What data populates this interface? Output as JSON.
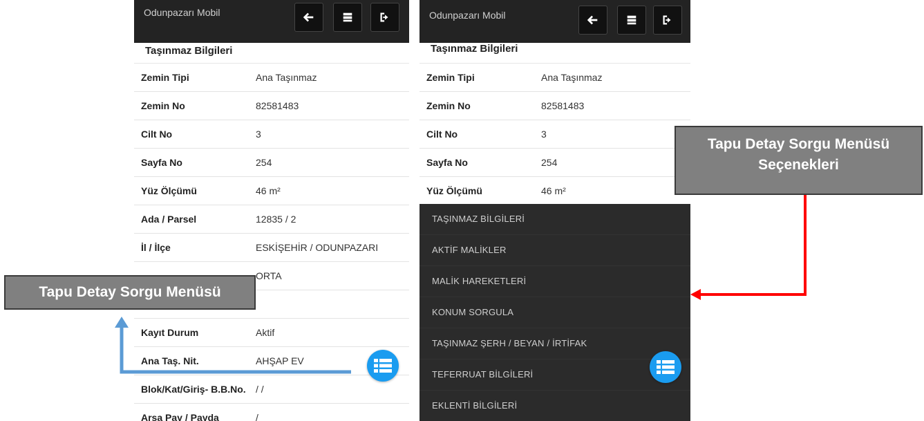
{
  "app": {
    "title": "Odunpazarı Mobil"
  },
  "header_buttons": [
    {
      "icon": "arrow-left-icon"
    },
    {
      "icon": "server-list-icon"
    },
    {
      "icon": "sign-out-icon"
    }
  ],
  "section_title": "Taşınmaz Bilgileri",
  "fields": [
    {
      "label": "Zemin Tipi",
      "value": "Ana Taşınmaz"
    },
    {
      "label": "Zemin No",
      "value": "82581483"
    },
    {
      "label": "Cilt No",
      "value": "3"
    },
    {
      "label": "Sayfa No",
      "value": "254"
    },
    {
      "label": "Yüz Ölçümü",
      "value": "46 m²"
    },
    {
      "label": "Ada / Parsel",
      "value": "12835  / 2"
    },
    {
      "label": "İl / İlçe",
      "value": "ESKİŞEHİR /  ODUNPAZARI"
    },
    {
      "label": "",
      "value": "ORTA"
    },
    {
      "label": "",
      "value": ""
    },
    {
      "label": "Kayıt Durum",
      "value": "Aktif"
    },
    {
      "label": "Ana Taş. Nit.",
      "value": "AHŞAP EV"
    },
    {
      "label": "Blok/Kat/Giriş- B.B.No.",
      "value": "/   /"
    },
    {
      "label": "Arsa Pay / Payda",
      "value": "/"
    }
  ],
  "menu_items": [
    "TAŞINMAZ BİLGİLERİ",
    "AKTİF MALİKLER",
    "MALİK HAREKETLERİ",
    "KONUM SORGULA",
    "TAŞINMAZ ŞERH / BEYAN / İRTİFAK",
    "TEFERRUAT BİLGİLERİ",
    "EKLENTİ BİLGİLERİ"
  ],
  "callouts": {
    "left": "Tapu Detay Sorgu Menüsü",
    "right_line1": "Tapu Detay Sorgu Menüsü",
    "right_line2": "Seçenekleri"
  },
  "colors": {
    "appbar": "#232323",
    "menu": "#2b2b2b",
    "fab": "#1a9cf0",
    "callout": "#808080",
    "arrow_blue": "#5b9bd5",
    "arrow_red": "#ff0000"
  }
}
